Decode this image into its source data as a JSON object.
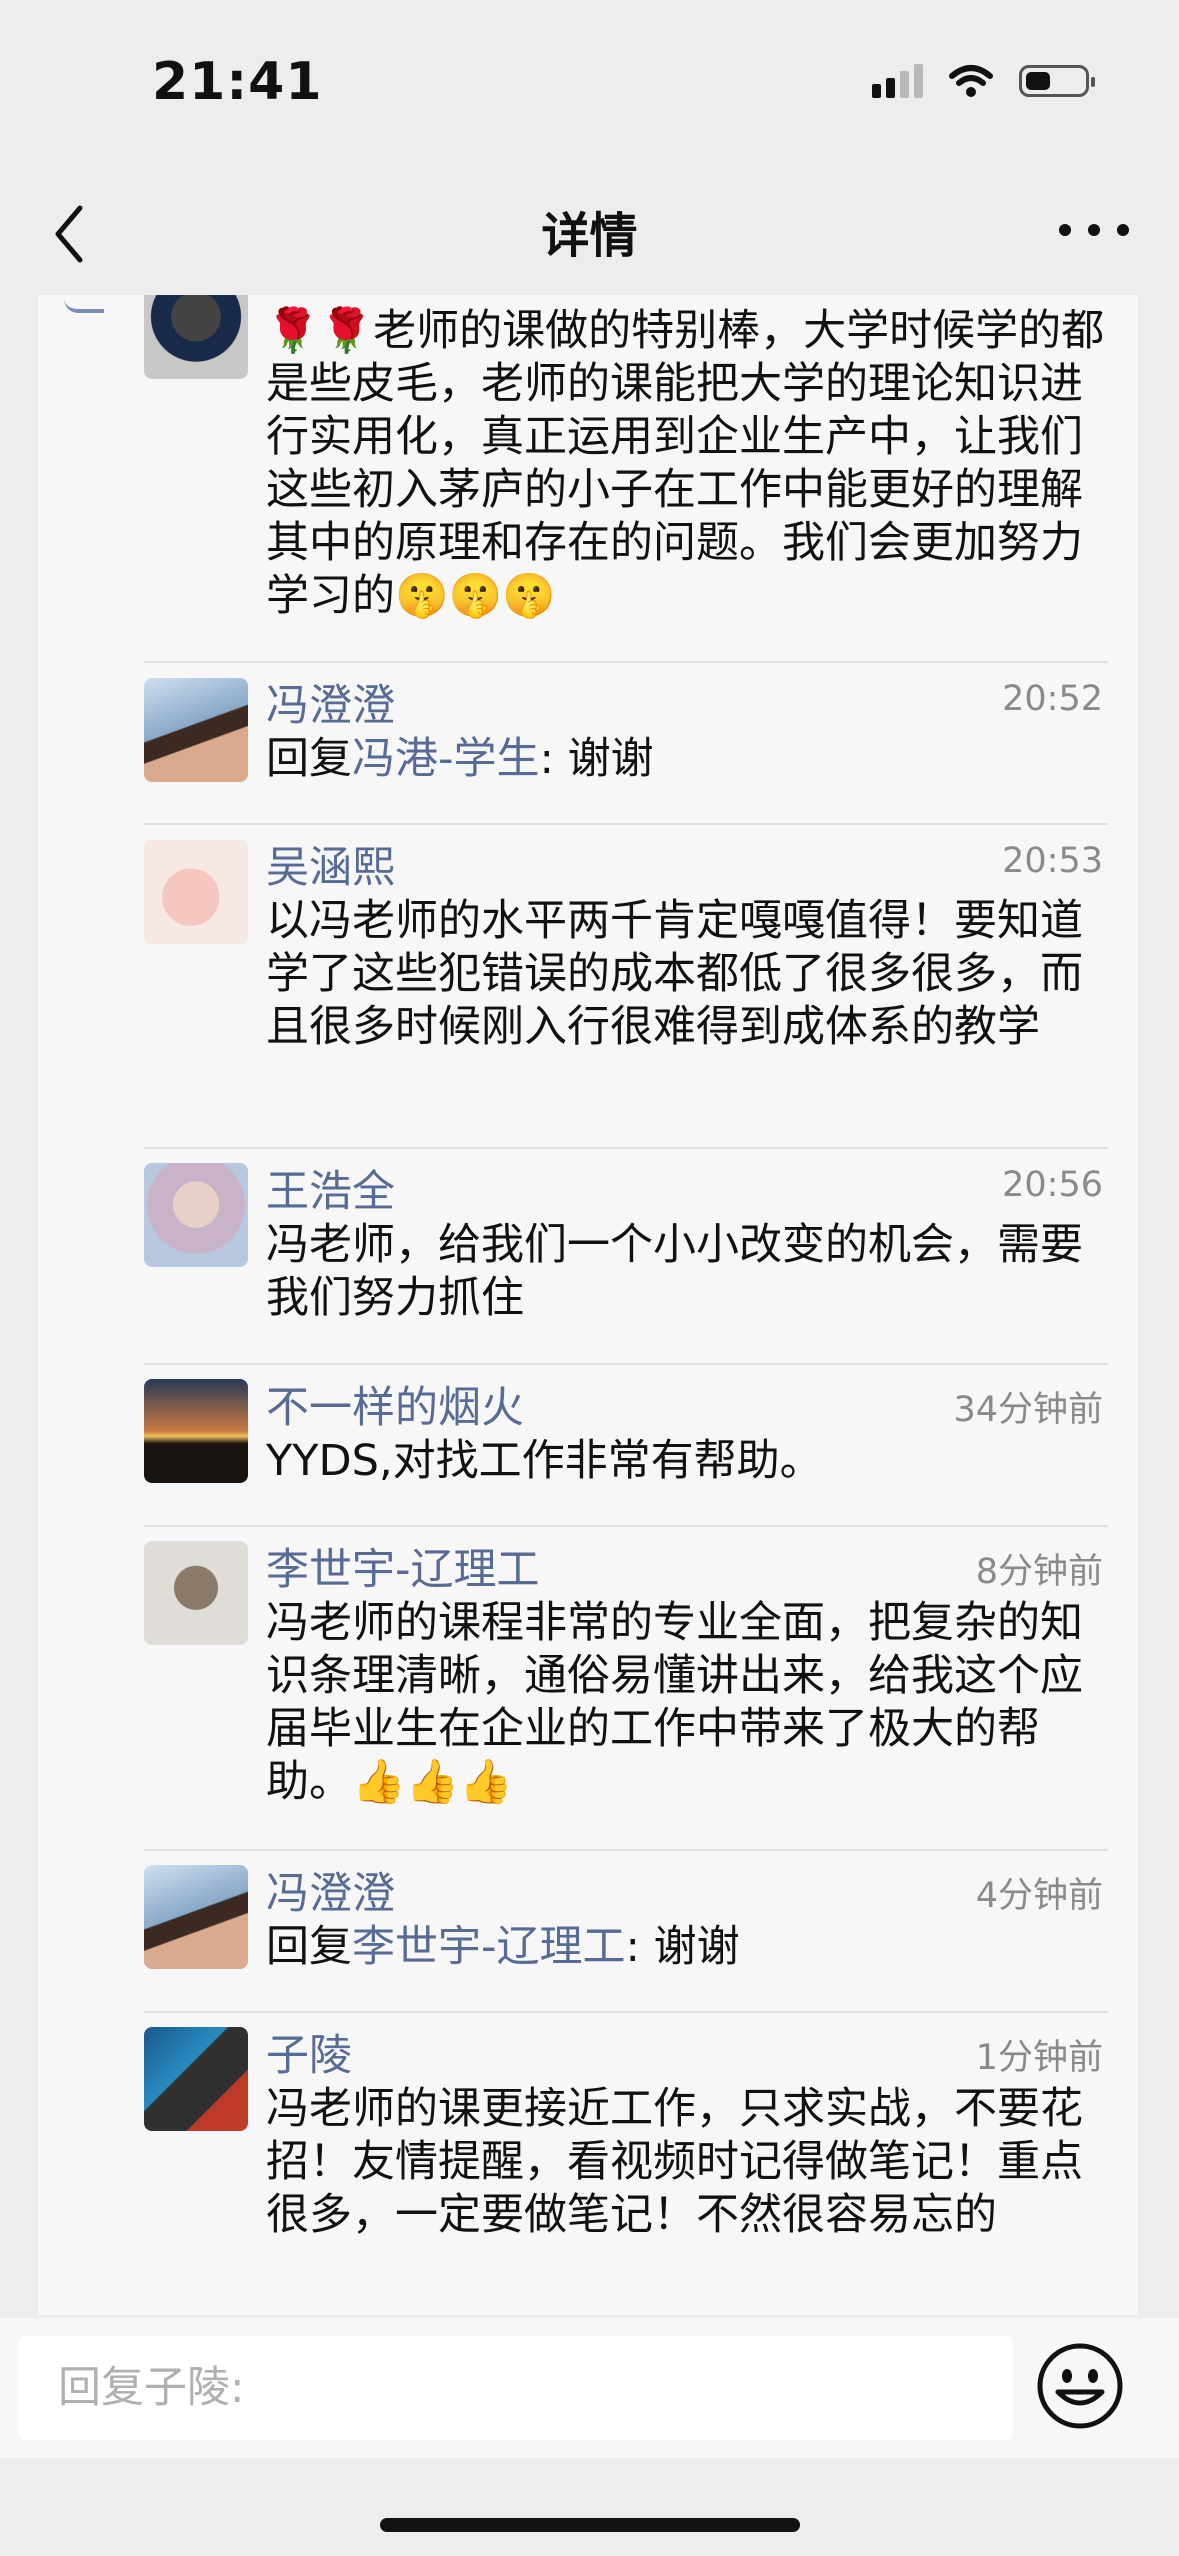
{
  "status_bar": {
    "time": "21:41"
  },
  "nav": {
    "title": "详情"
  },
  "comments": [
    {
      "text": "🌹🌹老师的课做的特别棒，大学时候学的都是些皮毛，老师的课能把大学的理论知识进行实用化，真正运用到企业生产中，让我们这些初入茅庐的小子在工作中能更好的理解其中的原理和存在的问题。我们会更加努力学习的🤫🤫🤫"
    },
    {
      "name": "冯澄澄",
      "time": "20:52",
      "reply_prefix": "回复",
      "reply_to": "冯港-学生",
      "reply_suffix": ": 谢谢"
    },
    {
      "name": "吴涵熙",
      "time": "20:53",
      "text": "以冯老师的水平两千肯定嘎嘎值得！要知道学了这些犯错误的成本都低了很多很多，而且很多时候刚入行很难得到成体系的教学"
    },
    {
      "name": "王浩全",
      "time": "20:56",
      "text": "冯老师，给我们一个小小改变的机会，需要我们努力抓住"
    },
    {
      "name": "不一样的烟火",
      "time": "34分钟前",
      "text": "YYDS,对找工作非常有帮助。"
    },
    {
      "name": "李世宇-辽理工",
      "time": "8分钟前",
      "text": "冯老师的课程非常的专业全面，把复杂的知识条理清晰，通俗易懂讲出来，给我这个应届毕业生在企业的工作中带来了极大的帮助。👍👍👍"
    },
    {
      "name": "冯澄澄",
      "time": "4分钟前",
      "reply_prefix": "回复",
      "reply_to": "李世宇-辽理工",
      "reply_suffix": ": 谢谢"
    },
    {
      "name": "子陵",
      "time": "1分钟前",
      "text": "冯老师的课更接近工作，只求实战，不要花招！友情提醒，看视频时记得做笔记！重点很多，一定要做笔记！不然很容易忘的"
    }
  ],
  "reply": {
    "placeholder": "回复子陵:"
  },
  "icons": {
    "back": "chevron-left-icon",
    "more": "more-dots-icon",
    "emoji": "smiley-face-icon",
    "signal": "cellular-signal-icon",
    "wifi": "wifi-icon",
    "battery": "battery-icon"
  },
  "colors": {
    "name_link": "#576b95",
    "timestamp": "#8a8a8a",
    "background": "#ededed",
    "panel": "#f7f7f7"
  }
}
